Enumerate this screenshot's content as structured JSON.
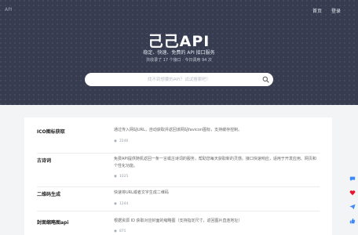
{
  "header": {
    "logo": "API",
    "nav": [
      {
        "label": "首页"
      },
      {
        "label": "登录"
      }
    ]
  },
  "hero": {
    "title": "己己API",
    "subtitle": "稳定、快速、免费的 API 接口服务",
    "stats": "共收录了 17 个接口 · 今日调用 94 次"
  },
  "search": {
    "placeholder": "找不到想要的API？试试搜索吧！"
  },
  "apis": [
    {
      "name": "ICO图标获取",
      "desc": "通过传入网站URL，自动获取并返回该网站favicon图标，支持缓存控制。",
      "count": "2246"
    },
    {
      "name": "古诗词",
      "desc": "免费API提供随机返回一条一言或古诗词的服务，帮助您每天获取新的灵感。接口快速响应，适用于开发应用、网页和个性化功能。",
      "count": "1025"
    },
    {
      "name": "二维码生成",
      "desc": "快速将URL或者文字生成二维码",
      "count": "1244"
    },
    {
      "name": "封面缩略图api",
      "desc": "根据资源 ID 获取对应封面的缩略图（支持指定尺寸，返回图片直连地址）",
      "count": "875"
    }
  ],
  "colors": {
    "hero_bg": "#373c50",
    "page_bg": "#f3f4f6",
    "wechat": "#3d8af7",
    "weibo": "#e6162d",
    "telegram": "#3d8af7",
    "like": "#3d8af7"
  },
  "side_icons": [
    "chat-icon",
    "heart-icon",
    "send-icon",
    "thumbs-up-icon"
  ]
}
